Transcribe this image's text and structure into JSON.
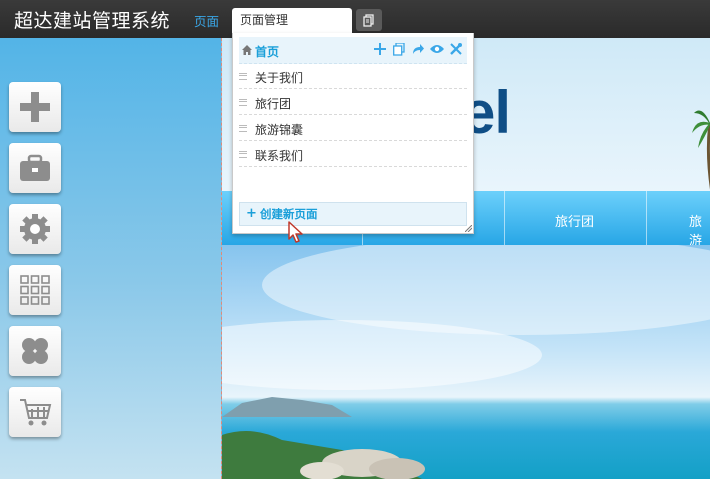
{
  "app": {
    "title": "超达建站管理系统"
  },
  "topbar": {
    "nav_label": "页面",
    "tab_label": "页面管理"
  },
  "site": {
    "logo_text": "el",
    "nav_items": [
      "旅行团",
      "旅游"
    ]
  },
  "page_panel": {
    "home_label": "首页",
    "pages": [
      "关于我们",
      "旅行团",
      "旅游锦囊",
      "联系我们"
    ],
    "create_label": "创建新页面"
  },
  "toolbar": {
    "tools": [
      "add-icon",
      "briefcase-icon",
      "gear-icon",
      "grid-icon",
      "clover-icon",
      "cart-icon"
    ]
  }
}
